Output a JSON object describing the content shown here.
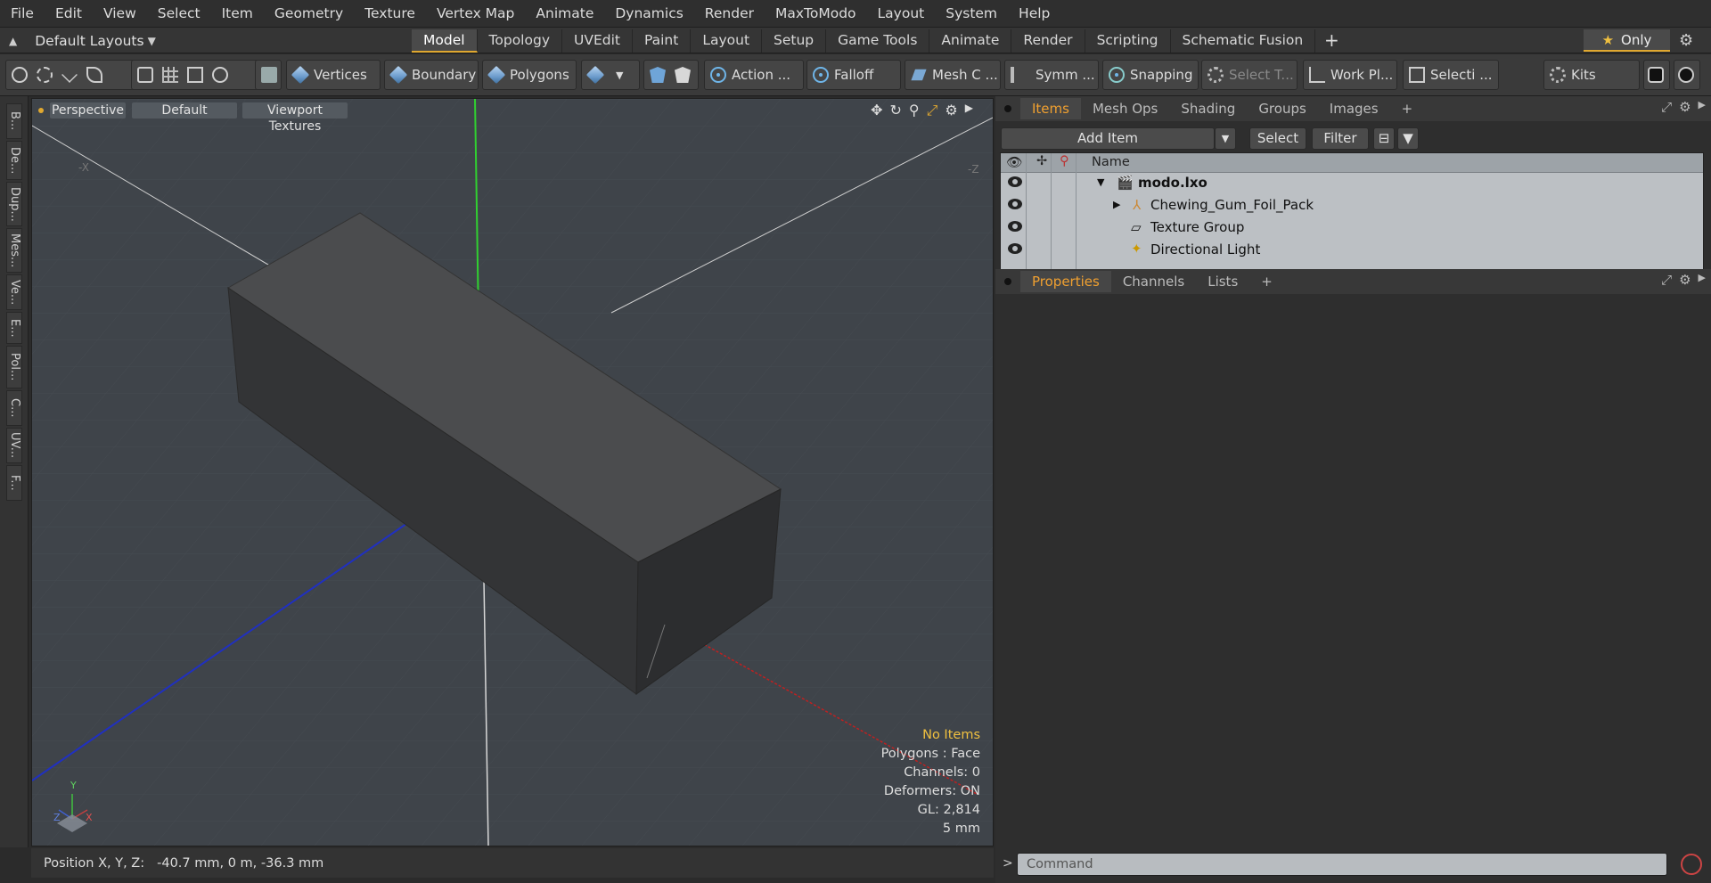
{
  "menu": [
    "File",
    "Edit",
    "View",
    "Select",
    "Item",
    "Geometry",
    "Texture",
    "Vertex Map",
    "Animate",
    "Dynamics",
    "Render",
    "MaxToModo",
    "Layout",
    "System",
    "Help"
  ],
  "layout_selector": "Default Layouts",
  "layout_tabs": [
    "Model",
    "Topology",
    "UVEdit",
    "Paint",
    "Layout",
    "Setup",
    "Game Tools",
    "Animate",
    "Render",
    "Scripting",
    "Schematic Fusion"
  ],
  "active_tab": "Model",
  "only_label": "Only",
  "toolbar": {
    "vertices": "Vertices",
    "boundary": "Boundary",
    "polygons": "Polygons",
    "action": "Action ...",
    "falloff": "Falloff",
    "mesh": "Mesh C ...",
    "symm": "Symm ...",
    "snapping": "Snapping",
    "select_t": "Select T...",
    "work_pl": "Work Pl...",
    "selecti": "Selecti ...",
    "kits": "Kits"
  },
  "left_tabs": [
    "B...",
    "De...",
    "Dup...",
    "Mes...",
    "Ve...",
    "E...",
    "Pol...",
    "C...",
    "UV...",
    "F..."
  ],
  "viewport": {
    "perspective": "Perspective",
    "default": "Default",
    "viewport_textures": "Viewport Textures",
    "axis_neg_x": "-X",
    "axis_neg_z": "-Z",
    "info": {
      "no_items": "No Items",
      "polygons": "Polygons : Face",
      "channels": "Channels: 0",
      "deformers": "Deformers: ON",
      "gl": "GL: 2,814",
      "units": "5 mm"
    }
  },
  "status": {
    "label": "Position X, Y, Z:",
    "value": "-40.7 mm, 0 m, -36.3 mm"
  },
  "items_panel": {
    "tabs": [
      "Items",
      "Mesh Ops",
      "Shading",
      "Groups",
      "Images"
    ],
    "active": "Items",
    "add_item": "Add Item",
    "select": "Select",
    "filter": "Filter",
    "name_header": "Name",
    "rows": [
      {
        "name": "modo.lxo",
        "bold": true
      },
      {
        "name": "Chewing_Gum_Foil_Pack",
        "bold": false
      },
      {
        "name": "Texture Group",
        "bold": false
      },
      {
        "name": "Directional Light",
        "bold": false
      }
    ]
  },
  "properties_panel": {
    "tabs": [
      "Properties",
      "Channels",
      "Lists"
    ],
    "active": "Properties"
  },
  "command_placeholder": "Command",
  "colors": {
    "accent": "#e0a830",
    "active_tab_text": "#f0a030",
    "viewport_bg": "#3f444a"
  }
}
